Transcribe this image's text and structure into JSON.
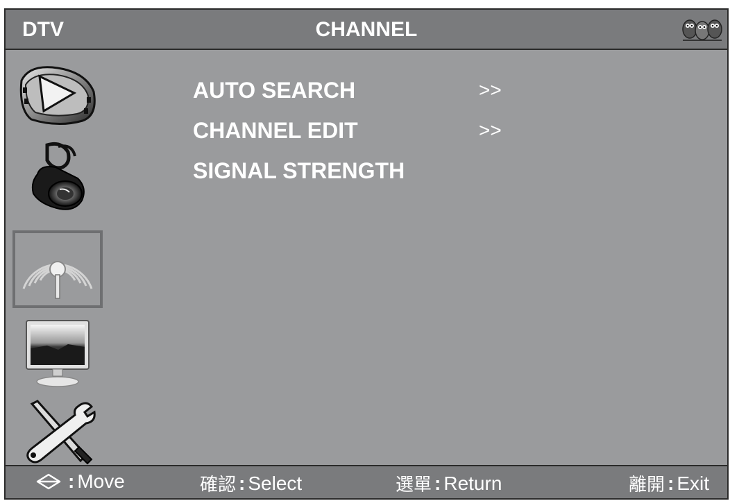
{
  "header": {
    "source": "DTV",
    "title": "CHANNEL"
  },
  "sidebar": {
    "items": [
      {
        "name": "picture",
        "icon": "film-play-icon",
        "selected": false
      },
      {
        "name": "sound",
        "icon": "speaker-icon",
        "selected": false
      },
      {
        "name": "channel",
        "icon": "antenna-signal-icon",
        "selected": true
      },
      {
        "name": "screen",
        "icon": "monitor-icon",
        "selected": false
      },
      {
        "name": "setup",
        "icon": "tools-icon",
        "selected": false
      }
    ]
  },
  "menu": {
    "items": [
      {
        "label": "AUTO SEARCH",
        "arrow": ">>"
      },
      {
        "label": "CHANNEL EDIT",
        "arrow": ">>"
      },
      {
        "label": "SIGNAL STRENGTH",
        "arrow": ""
      }
    ]
  },
  "footer": {
    "move_colon": ":",
    "move_label": "Move",
    "select_key": "確認",
    "select_colon": ":",
    "select_label": "Select",
    "return_key": "選單",
    "return_colon": ":",
    "return_label": "Return",
    "exit_key": "離開",
    "exit_colon": ":",
    "exit_label": "Exit"
  },
  "colors": {
    "screen_bg": "#9a9b9d",
    "bar_bg": "#7a7b7d",
    "text": "#ffffff",
    "selected_border": "#6e6f71"
  }
}
